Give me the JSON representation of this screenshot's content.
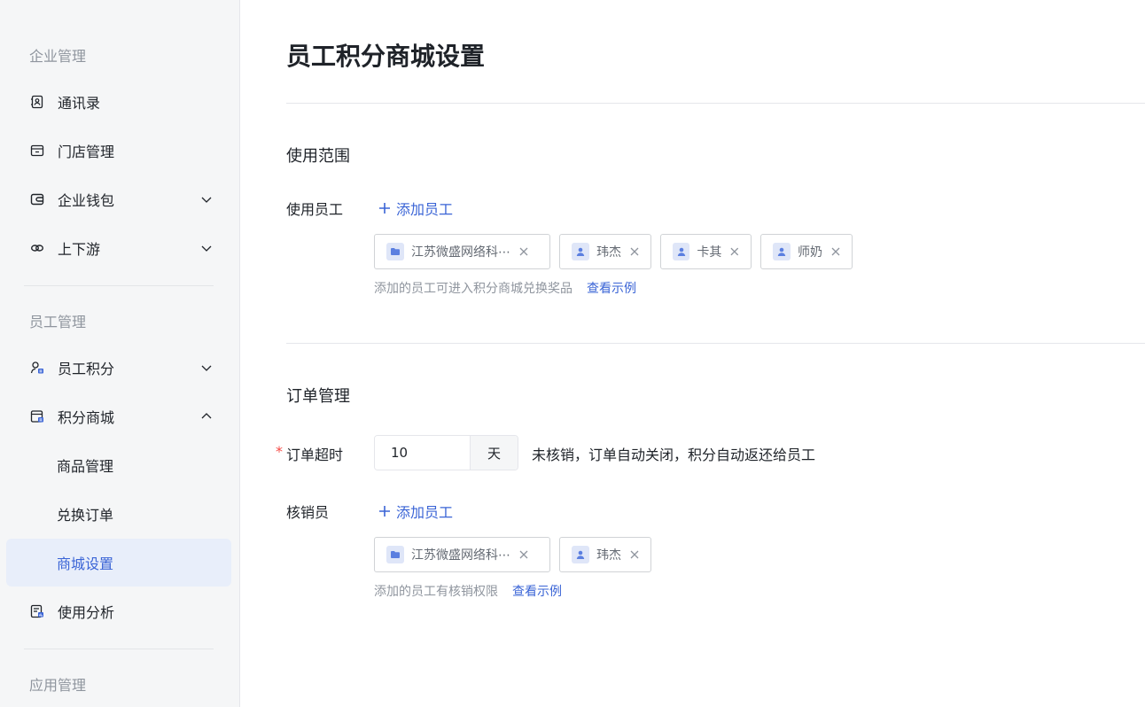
{
  "sidebar": {
    "groups": {
      "enterprise": "企业管理",
      "employee": "员工管理",
      "app": "应用管理"
    },
    "items": {
      "contacts": "通讯录",
      "stores": "门店管理",
      "wallet": "企业钱包",
      "chain": "上下游",
      "points": "员工积分",
      "mall": "积分商城",
      "products": "商品管理",
      "orders": "兑换订单",
      "mall_settings": "商城设置",
      "analysis": "使用分析"
    }
  },
  "main": {
    "title": "员工积分商城设置",
    "scope": {
      "title": "使用范围",
      "employees_label": "使用员工",
      "add_employee": "添加员工",
      "tags": [
        "江苏微盛网络科⋯",
        "玮杰",
        "卡其",
        "师奶"
      ],
      "hint": "添加的员工可进入积分商城兑换奖品",
      "example": "查看示例"
    },
    "order": {
      "title": "订单管理",
      "timeout_label": "订单超时",
      "required_mark": "*",
      "timeout_value": "10",
      "timeout_unit": "天",
      "timeout_desc": "未核销，订单自动关闭，积分自动返还给员工",
      "verifier_label": "核销员",
      "add_employee": "添加员工",
      "tags": [
        "江苏微盛网络科⋯",
        "玮杰"
      ],
      "hint": "添加的员工有核销权限",
      "example": "查看示例"
    }
  },
  "colors": {
    "accent": "#3a64d6",
    "sidebar_bg": "#f5f6f7",
    "active_bg": "#e8eefa",
    "required": "#f54a45"
  }
}
